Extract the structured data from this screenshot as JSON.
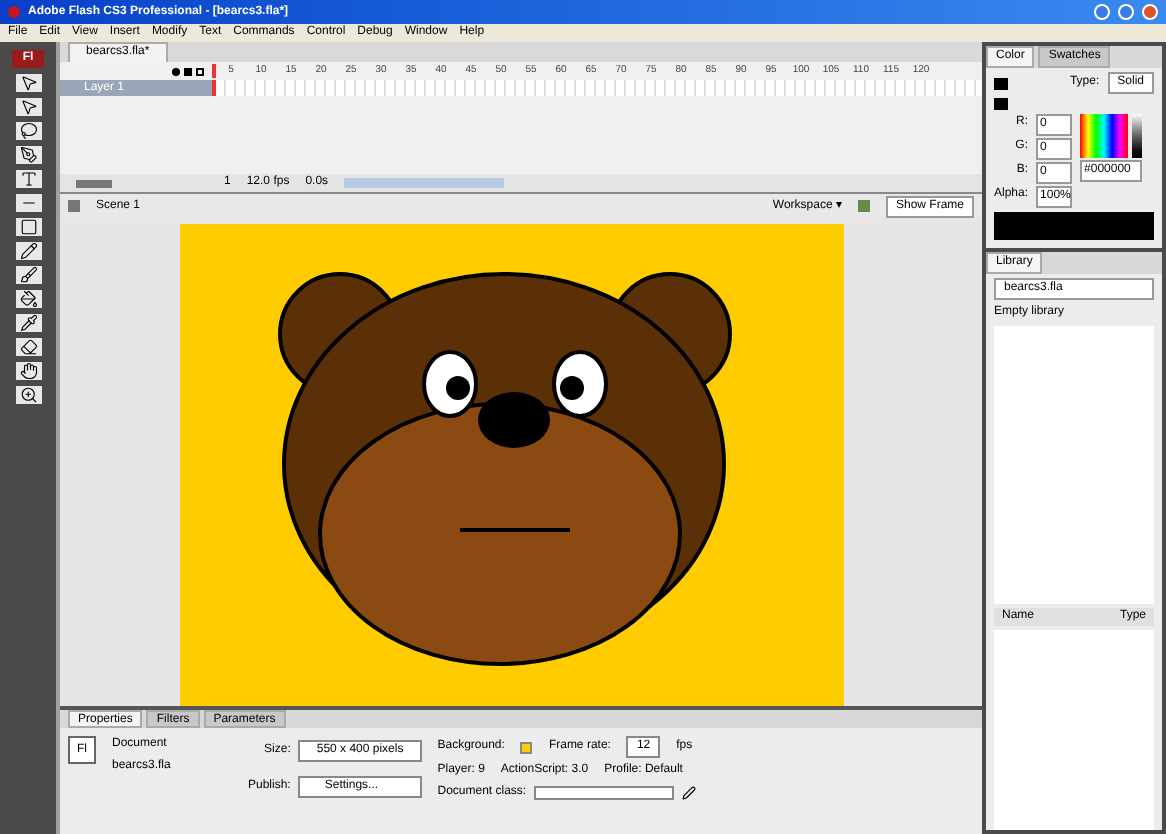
{
  "window": {
    "title": "Adobe Flash CS3 Professional - [bearcs3.fla*]"
  },
  "logo_text": "Fl",
  "menu": [
    "File",
    "Edit",
    "View",
    "Insert",
    "Modify",
    "Text",
    "Commands",
    "Control",
    "Debug",
    "Window",
    "Help"
  ],
  "document_tab": "bearcs3.fla*",
  "timeline": {
    "layers": [
      {
        "name": "Layer 1",
        "selected": true
      }
    ],
    "ruler": [
      "5",
      "10",
      "15",
      "20",
      "25",
      "30",
      "35",
      "40",
      "45",
      "50",
      "55",
      "60",
      "65",
      "70",
      "75",
      "80",
      "85",
      "90",
      "95",
      "100",
      "105",
      "110",
      "115",
      "120"
    ],
    "frame": "1",
    "fps": "12.0 fps",
    "time": "0.0s"
  },
  "edit_bar": {
    "scene": "Scene 1",
    "workspace": "Workspace ▾",
    "show_frame": "Show Frame"
  },
  "color_panel": {
    "tabs": [
      {
        "label": "Color",
        "selected": true
      },
      {
        "label": "Swatches",
        "selected": false
      }
    ],
    "type_label": "Type:",
    "type_value": "Solid",
    "channels": [
      {
        "label": "R:",
        "value": "0"
      },
      {
        "label": "G:",
        "value": "0"
      },
      {
        "label": "B:",
        "value": "0"
      },
      {
        "label": "Alpha:",
        "value": "100%"
      }
    ],
    "hex": "#000000"
  },
  "library_panel": {
    "tab": "Library",
    "file": "bearcs3.fla",
    "status": "Empty library",
    "columns": [
      "Name",
      "Type"
    ]
  },
  "properties": {
    "tabs": [
      {
        "label": "Properties",
        "selected": true
      },
      {
        "label": "Filters",
        "selected": false
      },
      {
        "label": "Parameters",
        "selected": false
      }
    ],
    "icon_text": "Fl",
    "doc_label": "Document",
    "doc_name": "bearcs3.fla",
    "size_label": "Size:",
    "size_value": "550 x 400 pixels",
    "publish_label": "Publish:",
    "publish_button": "Settings...",
    "background_label": "Background:",
    "frame_rate_label": "Frame rate:",
    "frame_rate": "12",
    "fps_unit": "fps",
    "player": "Player: 9",
    "actionscript": "ActionScript: 3.0",
    "profile": "Profile: Default",
    "doc_class_label": "Document class:"
  }
}
